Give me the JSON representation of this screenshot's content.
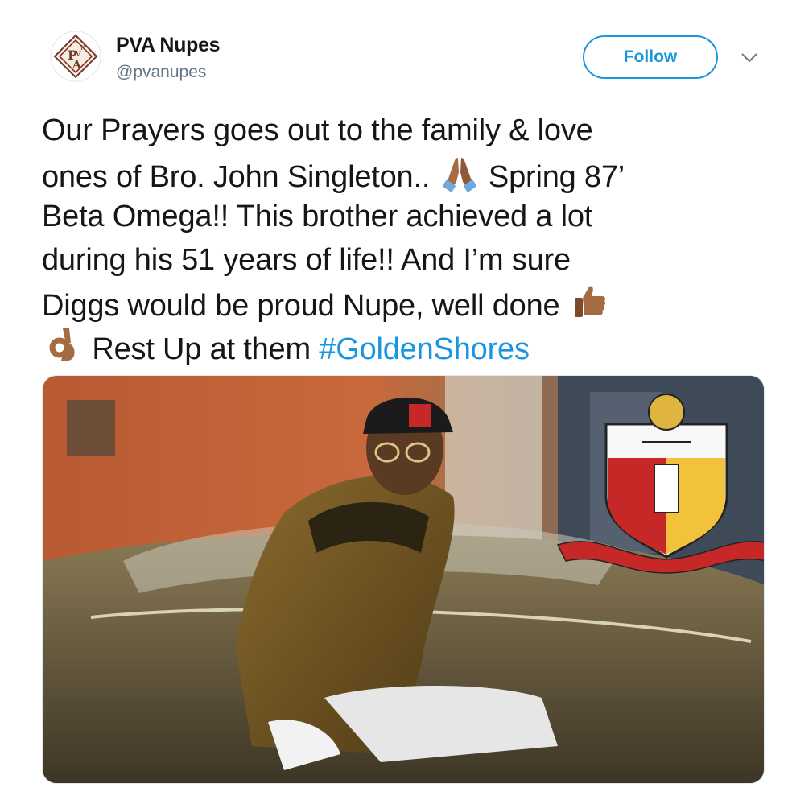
{
  "user": {
    "display_name": "PVA Nupes",
    "handle": "@pvanupes",
    "avatar_icon": "pva-crest-avatar"
  },
  "header": {
    "follow_label": "Follow",
    "more_icon": "chevron-down-icon"
  },
  "tweet": {
    "line1": "Our Prayers goes out to the family & love",
    "line2a": "ones of Bro. John Singleton..",
    "line2b": "Spring 87’",
    "line3": "Beta Omega!! This brother achieved a lot",
    "line4": "during his 51 years of life!! And I’m sure",
    "line5": "Diggs would be proud Nupe,  well done",
    "line6a": "Rest Up at them",
    "hashtag": "#GoldenShores",
    "emojis": [
      "folded-hands-icon",
      "thumbs-up-icon",
      "ok-hand-icon"
    ]
  },
  "media": {
    "image_icon": "tweet-photo",
    "crest_icon": "kappa-alpha-psi-crest-icon"
  },
  "colors": {
    "link": "#1b95e0",
    "text": "#14171a",
    "secondary": "#657786"
  }
}
